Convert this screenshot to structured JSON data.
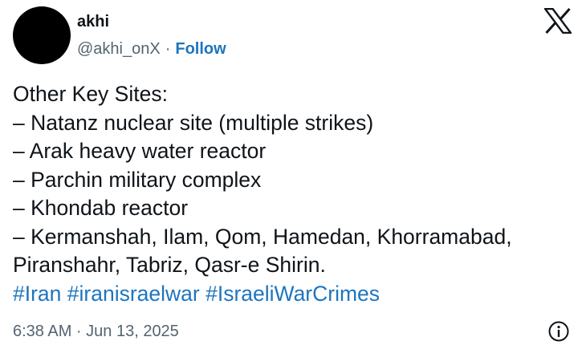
{
  "author": {
    "display_name": "akhi",
    "handle": "@akhi_onX",
    "separator": "·",
    "follow_label": "Follow"
  },
  "logo_icon": "x-logo-icon",
  "body": {
    "lines": [
      "Other Key Sites:",
      "– Natanz nuclear site (multiple strikes)",
      "– Arak heavy water reactor",
      "– Parchin military complex",
      "– Khondab reactor",
      "– Kermanshah, Ilam, Qom, Hamedan, Khorramabad,",
      "Piranshahr, Tabriz, Qasr-e Shirin."
    ],
    "hashtags": [
      "#Iran",
      "#iranisraelwar",
      "#IsraeliWarCrimes"
    ]
  },
  "footer": {
    "timestamp": "6:38 AM · Jun 13, 2025",
    "info_icon": "info-icon"
  },
  "colors": {
    "link": "#1d75bf",
    "text": "#0f1419",
    "secondary": "#536471",
    "avatar": "#000000"
  }
}
